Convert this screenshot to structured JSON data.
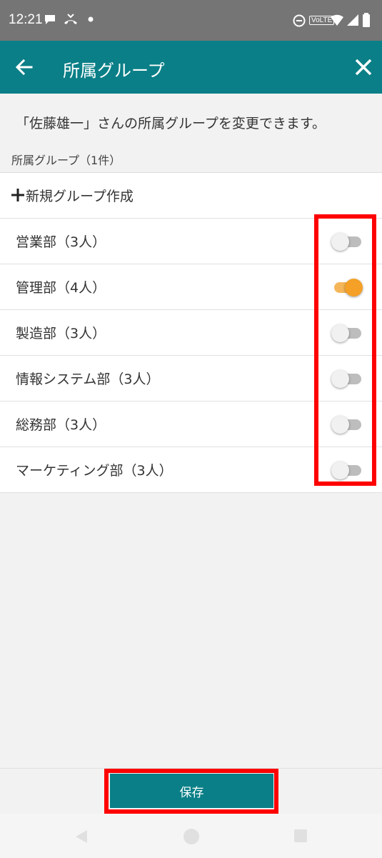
{
  "status_bar": {
    "time": "12:21",
    "volte": "VoLTE"
  },
  "app_bar": {
    "title": "所属グループ"
  },
  "description": "「佐藤雄一」さんの所属グループを変更できます。",
  "section_label": "所属グループ（1件）",
  "new_group_label": "新規グループ作成",
  "groups": [
    {
      "label": "営業部（3人）",
      "enabled": false
    },
    {
      "label": "管理部（4人）",
      "enabled": true
    },
    {
      "label": "製造部（3人）",
      "enabled": false
    },
    {
      "label": "情報システム部（3人）",
      "enabled": false
    },
    {
      "label": "総務部（3人）",
      "enabled": false
    },
    {
      "label": "マーケティング部（3人）",
      "enabled": false
    }
  ],
  "save_label": "保存",
  "colors": {
    "primary": "#0a7f87",
    "toggle_on": "#f5a026",
    "highlight": "#ff0000"
  }
}
